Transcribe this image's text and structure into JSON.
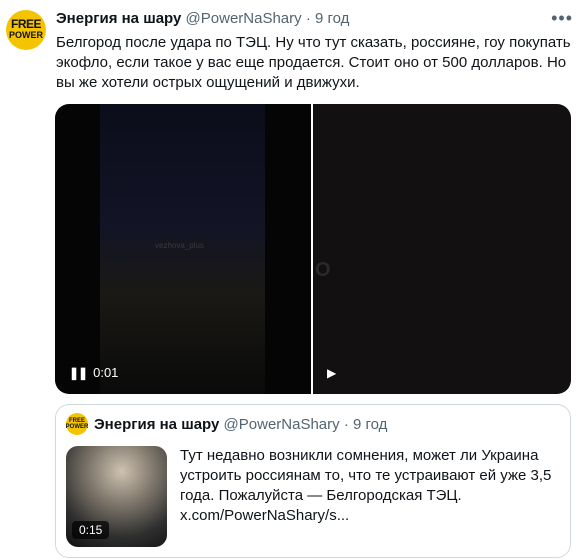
{
  "tweet": {
    "avatar_line1": "FREE",
    "avatar_line2": "POWER",
    "author_name": "Энергия на шару",
    "author_handle": "@PowerNaShary",
    "separator": "·",
    "time": "9 год",
    "more_icon": "more-icon",
    "text": "Белгород после удара по ТЭЦ. Ну что тут сказать, россияне, гоу покупать экофло, если такое у вас еще продается. Стоит оно от 500 долларов. Но вы же хотели острых ощущений и движухи.",
    "video1": {
      "watermark": "vezhova_plus",
      "time": "0:01",
      "icon": "pause-icon"
    },
    "video2": {
      "watermark": "O",
      "icon": "play-icon"
    }
  },
  "quote": {
    "avatar_line1": "FREE",
    "avatar_line2": "POWER",
    "author_name": "Энергия на шару",
    "author_handle": "@PowerNaShary",
    "separator": "·",
    "time": "9 год",
    "duration": "0:15",
    "text": "Тут недавно возникли сомнения, может ли Украина устроить россиянам то, что те устраивают ей уже 3,5 года. Пожалуйста — Белгородская ТЭЦ. x.com/PowerNaShary/s..."
  }
}
